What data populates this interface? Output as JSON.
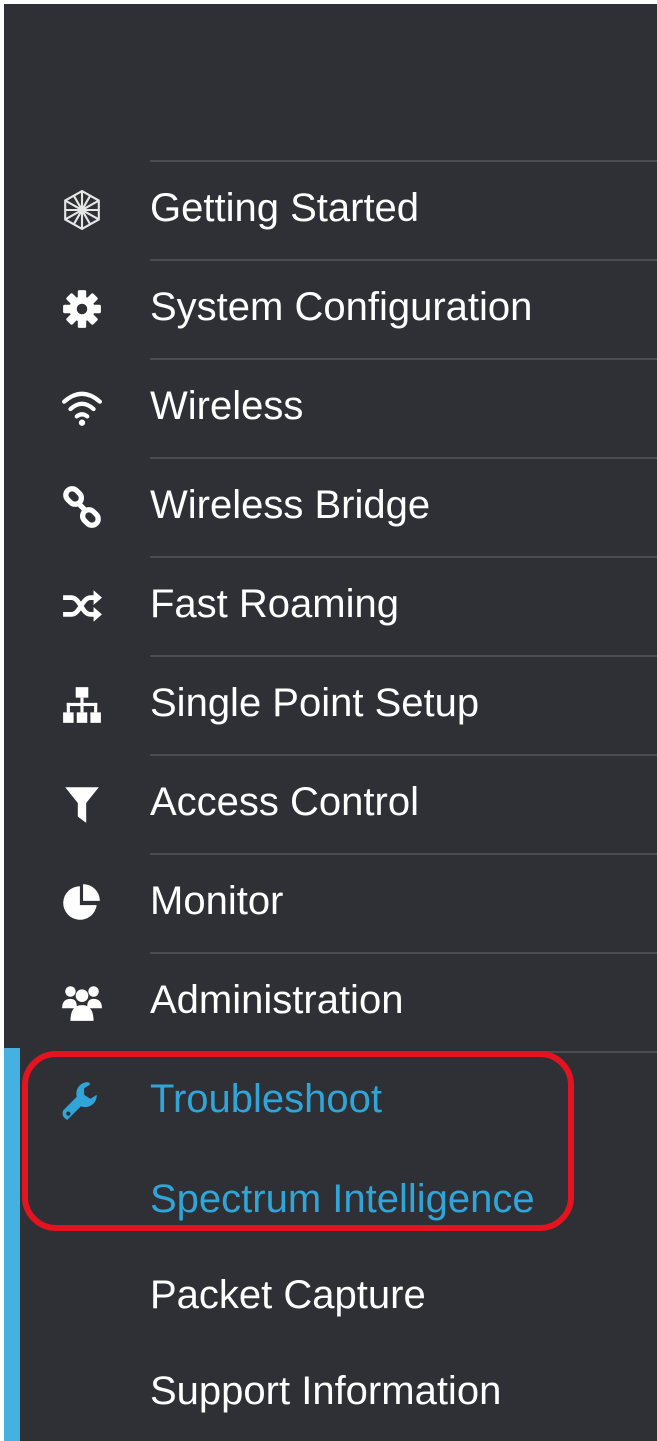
{
  "nav": {
    "items": [
      {
        "key": "getting-started",
        "label": "Getting Started",
        "icon": "hexagon-network-icon"
      },
      {
        "key": "system-configuration",
        "label": "System Configuration",
        "icon": "gear-icon"
      },
      {
        "key": "wireless",
        "label": "Wireless",
        "icon": "wifi-icon"
      },
      {
        "key": "wireless-bridge",
        "label": "Wireless Bridge",
        "icon": "link-icon"
      },
      {
        "key": "fast-roaming",
        "label": "Fast Roaming",
        "icon": "shuffle-icon"
      },
      {
        "key": "single-point-setup",
        "label": "Single Point Setup",
        "icon": "sitemap-icon"
      },
      {
        "key": "access-control",
        "label": "Access Control",
        "icon": "filter-icon"
      },
      {
        "key": "monitor",
        "label": "Monitor",
        "icon": "pie-chart-icon"
      },
      {
        "key": "administration",
        "label": "Administration",
        "icon": "users-icon"
      },
      {
        "key": "troubleshoot",
        "label": "Troubleshoot",
        "icon": "wrench-icon",
        "active": true
      }
    ],
    "troubleshoot_subitems": [
      {
        "key": "spectrum-intelligence",
        "label": "Spectrum Intelligence",
        "active": true
      },
      {
        "key": "packet-capture",
        "label": "Packet Capture"
      },
      {
        "key": "support-information",
        "label": "Support Information"
      }
    ]
  },
  "colors": {
    "background": "#2f3035",
    "text": "#ffffff",
    "active_text": "#2fa5d8",
    "active_bar": "#44b1e0",
    "highlight": "#e3131f"
  }
}
